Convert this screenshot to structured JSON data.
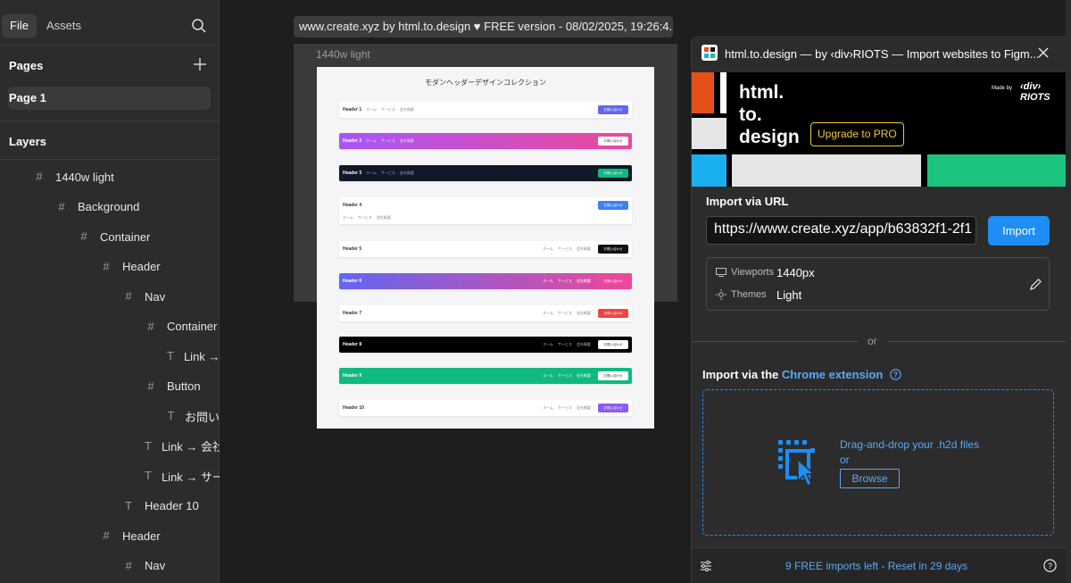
{
  "left_panel": {
    "tabs": [
      "File",
      "Assets"
    ],
    "pages_heading": "Pages",
    "current_page": "Page 1",
    "layers_heading": "Layers",
    "layers": [
      {
        "icon": "frame",
        "label": "1440w light"
      },
      {
        "icon": "frame",
        "label": "Background"
      },
      {
        "icon": "frame",
        "label": "Container"
      },
      {
        "icon": "frame",
        "label": "Header"
      },
      {
        "icon": "frame",
        "label": "Nav"
      },
      {
        "icon": "frame",
        "label": "Container"
      },
      {
        "icon": "text",
        "label": "Link →"
      },
      {
        "icon": "frame",
        "label": "Button"
      },
      {
        "icon": "text",
        "label": "お問い"
      },
      {
        "icon": "text",
        "label": "Link → 会社"
      },
      {
        "icon": "text",
        "label": "Link → サー"
      },
      {
        "icon": "text",
        "label": "Header 10"
      },
      {
        "icon": "frame",
        "label": "Header"
      },
      {
        "icon": "frame",
        "label": "Nav"
      }
    ]
  },
  "canvas": {
    "tab_title": "www.create.xyz by html.to.design ♥ FREE version - 08/02/2025, 19:26:4...",
    "frame_label": "1440w light",
    "frame_title": "モダンヘッダーデザインコレクション",
    "nav_home": "ホーム",
    "nav_services": "サービス",
    "nav_company": "会社概要",
    "contact": "お問い合わせ",
    "headers": [
      {
        "name": "Header 1",
        "style": "light",
        "accent": "#6366f1"
      },
      {
        "name": "Header 2",
        "style": "gradient-purple",
        "accent": "#ffffff"
      },
      {
        "name": "Header 3",
        "style": "dark",
        "accent": "#10b981"
      },
      {
        "name": "Header 4",
        "style": "light-tall",
        "accent": "#3b82f6"
      },
      {
        "name": "Header 5",
        "style": "light-right",
        "accent": "#111111"
      },
      {
        "name": "Header 6",
        "style": "gradient-blue",
        "accent": "#ec4899"
      },
      {
        "name": "Header 7",
        "style": "light-right",
        "accent": "#ef4444"
      },
      {
        "name": "Header 8",
        "style": "black",
        "accent": "#ffffff"
      },
      {
        "name": "Header 9",
        "style": "green",
        "accent": "#ffffff"
      },
      {
        "name": "Header 10",
        "style": "light-right",
        "accent": "#8b5cf6"
      }
    ]
  },
  "plugin": {
    "title": "html.to.design — by ‹div›RIOTS — Import websites to Figm...",
    "banner": {
      "line1": "html.",
      "line2": "to.",
      "line3": "design",
      "upgrade": "Upgrade to PRO",
      "made_by": "Made by",
      "brand": "‹div› RIOTS"
    },
    "import_url_label": "Import via URL",
    "url_value": "https://www.create.xyz/app/b63832f1-2f1",
    "import_button": "Import",
    "viewports_label": "Viewports",
    "viewports_value": "1440px",
    "themes_label": "Themes",
    "themes_value": "Light",
    "or": "or",
    "chrome_prefix": "Import via the ",
    "chrome_link": "Chrome extension",
    "drag_text": "Drag-and-drop your .h2d files",
    "drag_or": "or",
    "browse": "Browse",
    "footer_text": "9 FREE imports left - Reset in 29 days",
    "accent": "#1e8ef5"
  }
}
